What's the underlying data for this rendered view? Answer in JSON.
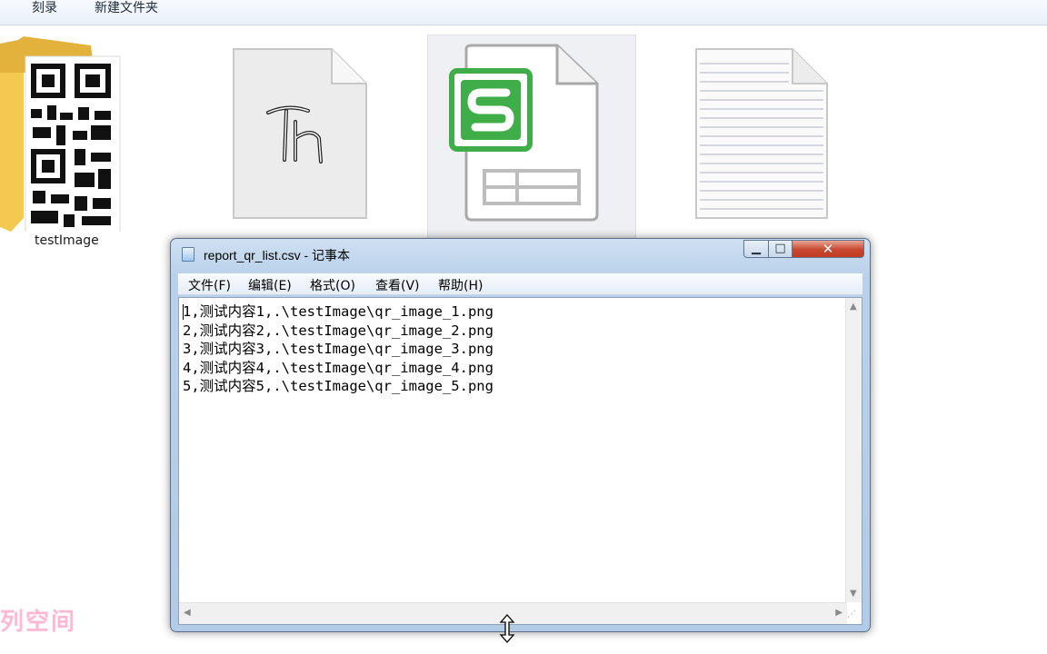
{
  "explorer": {
    "toolbar": {
      "burn_label": "刻录",
      "new_folder_label": "新建文件夹"
    },
    "files": [
      {
        "name": "testImage",
        "kind": "folder"
      },
      {
        "name": "",
        "kind": "thonny-script"
      },
      {
        "name": "",
        "kind": "csv-spreadsheet"
      },
      {
        "name": "",
        "kind": "text-file"
      }
    ]
  },
  "notepad": {
    "title": "report_qr_list.csv - 记事本",
    "controls": {
      "minimize": "▁",
      "maximize": "□",
      "close": "✕"
    },
    "menu": [
      "文件(F)",
      "编辑(E)",
      "格式(O)",
      "查看(V)",
      "帮助(H)"
    ],
    "content": "1,测试内容1,.\\testImage\\qr_image_1.png\n2,测试内容2,.\\testImage\\qr_image_2.png\n3,测试内容3,.\\testImage\\qr_image_3.png\n4,测试内容4,.\\testImage\\qr_image_4.png\n5,测试内容5,.\\testImage\\qr_image_5.png"
  },
  "icons": {
    "folder": "folder-icon",
    "script": "thonny-file-icon",
    "spreadsheet": "spreadsheet-file-icon",
    "text": "text-file-icon",
    "cursor": "resize-vertical-cursor-icon"
  },
  "colors": {
    "folder_yellow": "#f3c94f",
    "sheet_green": "#3fae49",
    "close_red": "#c8472f",
    "watermark_pink": "#ffb7d3"
  },
  "watermark": "列空间"
}
